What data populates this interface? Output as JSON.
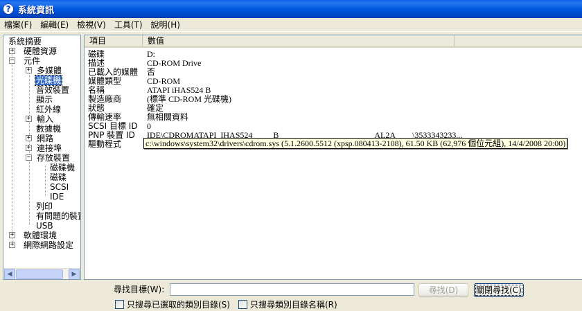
{
  "window": {
    "title": "系統資訊",
    "icon": "question-icon",
    "accent": "#0058e0"
  },
  "menubar": [
    {
      "label": "檔案(F)"
    },
    {
      "label": "編輯(E)"
    },
    {
      "label": "檢視(V)"
    },
    {
      "label": "工具(T)"
    },
    {
      "label": "說明(H)"
    }
  ],
  "tree": {
    "root": "系統摘要",
    "items": [
      {
        "label": "硬體資源",
        "expander": "+"
      },
      {
        "label": "元件",
        "expander": "−"
      },
      {
        "label": "多媒體",
        "expander": "+"
      },
      {
        "label": "光碟機",
        "selected": true
      },
      {
        "label": "音效裝置"
      },
      {
        "label": "顯示"
      },
      {
        "label": "紅外線"
      },
      {
        "label": "輸入",
        "expander": "+"
      },
      {
        "label": "數據機"
      },
      {
        "label": "網路",
        "expander": "+"
      },
      {
        "label": "連接埠",
        "expander": "+"
      },
      {
        "label": "存放裝置",
        "expander": "−"
      },
      {
        "label": "磁碟機"
      },
      {
        "label": "磁碟"
      },
      {
        "label": "SCSI"
      },
      {
        "label": "IDE"
      },
      {
        "label": "列印"
      },
      {
        "label": "有問題的裝置"
      },
      {
        "label": "USB"
      },
      {
        "label": "軟體環境",
        "expander": "+"
      },
      {
        "label": "網際網路設定",
        "expander": "+"
      }
    ]
  },
  "list": {
    "columns": [
      "項目",
      "數值"
    ],
    "rows": [
      {
        "item": "磁碟",
        "value": "D:"
      },
      {
        "item": "描述",
        "value": "CD-ROM Drive"
      },
      {
        "item": "已載入的媒體",
        "value": "否"
      },
      {
        "item": "媒體類型",
        "value": "CD-ROM"
      },
      {
        "item": "名稱",
        "value": "ATAPI iHAS524   B"
      },
      {
        "item": "製造廠商",
        "value": "(標準 CD-ROM 光碟機)"
      },
      {
        "item": "狀態",
        "value": "確定"
      },
      {
        "item": "傳輸速率",
        "value": "無相關資料"
      },
      {
        "item": "SCSI 目標 ID",
        "value": "0"
      },
      {
        "item": "PNP 裝置 ID",
        "value": "IDE\\CDROMATAPI_IHAS524_____B_______________________AL2A____\\3533343233..."
      },
      {
        "item": "驅動程式",
        "value": ""
      }
    ],
    "tooltip": "c:\\windows\\system32\\drivers\\cdrom.sys (5.1.2600.5512 (xpsp.080413-2108), 61.50 KB (62,976 個位元組), 14/4/2008 20:00)"
  },
  "find": {
    "label": "尋找目標(W):",
    "value": "",
    "find_button": "尋找(D)",
    "close_button": "關閉尋找(C)",
    "option1": "只搜尋已選取的類別目錄(S)",
    "option2": "只搜尋類別目錄名稱(R)"
  },
  "scrollbar": {
    "left_arrow": "◀",
    "right_arrow": "▶"
  }
}
